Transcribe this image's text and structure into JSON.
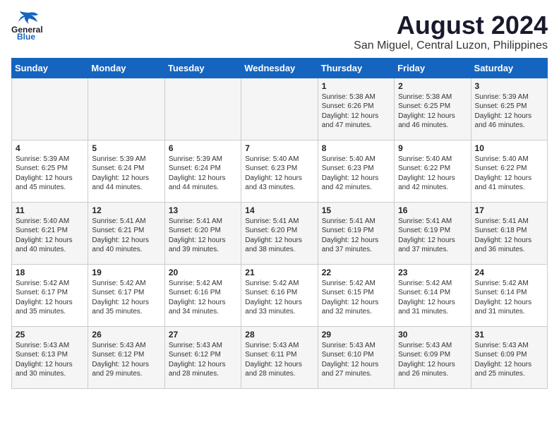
{
  "header": {
    "logo_general": "General",
    "logo_blue": "Blue",
    "month_year": "August 2024",
    "location": "San Miguel, Central Luzon, Philippines"
  },
  "days_of_week": [
    "Sunday",
    "Monday",
    "Tuesday",
    "Wednesday",
    "Thursday",
    "Friday",
    "Saturday"
  ],
  "weeks": [
    [
      {
        "day": "",
        "content": ""
      },
      {
        "day": "",
        "content": ""
      },
      {
        "day": "",
        "content": ""
      },
      {
        "day": "",
        "content": ""
      },
      {
        "day": "1",
        "content": "Sunrise: 5:38 AM\nSunset: 6:26 PM\nDaylight: 12 hours\nand 47 minutes."
      },
      {
        "day": "2",
        "content": "Sunrise: 5:38 AM\nSunset: 6:25 PM\nDaylight: 12 hours\nand 46 minutes."
      },
      {
        "day": "3",
        "content": "Sunrise: 5:39 AM\nSunset: 6:25 PM\nDaylight: 12 hours\nand 46 minutes."
      }
    ],
    [
      {
        "day": "4",
        "content": "Sunrise: 5:39 AM\nSunset: 6:25 PM\nDaylight: 12 hours\nand 45 minutes."
      },
      {
        "day": "5",
        "content": "Sunrise: 5:39 AM\nSunset: 6:24 PM\nDaylight: 12 hours\nand 44 minutes."
      },
      {
        "day": "6",
        "content": "Sunrise: 5:39 AM\nSunset: 6:24 PM\nDaylight: 12 hours\nand 44 minutes."
      },
      {
        "day": "7",
        "content": "Sunrise: 5:40 AM\nSunset: 6:23 PM\nDaylight: 12 hours\nand 43 minutes."
      },
      {
        "day": "8",
        "content": "Sunrise: 5:40 AM\nSunset: 6:23 PM\nDaylight: 12 hours\nand 42 minutes."
      },
      {
        "day": "9",
        "content": "Sunrise: 5:40 AM\nSunset: 6:22 PM\nDaylight: 12 hours\nand 42 minutes."
      },
      {
        "day": "10",
        "content": "Sunrise: 5:40 AM\nSunset: 6:22 PM\nDaylight: 12 hours\nand 41 minutes."
      }
    ],
    [
      {
        "day": "11",
        "content": "Sunrise: 5:40 AM\nSunset: 6:21 PM\nDaylight: 12 hours\nand 40 minutes."
      },
      {
        "day": "12",
        "content": "Sunrise: 5:41 AM\nSunset: 6:21 PM\nDaylight: 12 hours\nand 40 minutes."
      },
      {
        "day": "13",
        "content": "Sunrise: 5:41 AM\nSunset: 6:20 PM\nDaylight: 12 hours\nand 39 minutes."
      },
      {
        "day": "14",
        "content": "Sunrise: 5:41 AM\nSunset: 6:20 PM\nDaylight: 12 hours\nand 38 minutes."
      },
      {
        "day": "15",
        "content": "Sunrise: 5:41 AM\nSunset: 6:19 PM\nDaylight: 12 hours\nand 37 minutes."
      },
      {
        "day": "16",
        "content": "Sunrise: 5:41 AM\nSunset: 6:19 PM\nDaylight: 12 hours\nand 37 minutes."
      },
      {
        "day": "17",
        "content": "Sunrise: 5:41 AM\nSunset: 6:18 PM\nDaylight: 12 hours\nand 36 minutes."
      }
    ],
    [
      {
        "day": "18",
        "content": "Sunrise: 5:42 AM\nSunset: 6:17 PM\nDaylight: 12 hours\nand 35 minutes."
      },
      {
        "day": "19",
        "content": "Sunrise: 5:42 AM\nSunset: 6:17 PM\nDaylight: 12 hours\nand 35 minutes."
      },
      {
        "day": "20",
        "content": "Sunrise: 5:42 AM\nSunset: 6:16 PM\nDaylight: 12 hours\nand 34 minutes."
      },
      {
        "day": "21",
        "content": "Sunrise: 5:42 AM\nSunset: 6:16 PM\nDaylight: 12 hours\nand 33 minutes."
      },
      {
        "day": "22",
        "content": "Sunrise: 5:42 AM\nSunset: 6:15 PM\nDaylight: 12 hours\nand 32 minutes."
      },
      {
        "day": "23",
        "content": "Sunrise: 5:42 AM\nSunset: 6:14 PM\nDaylight: 12 hours\nand 31 minutes."
      },
      {
        "day": "24",
        "content": "Sunrise: 5:42 AM\nSunset: 6:14 PM\nDaylight: 12 hours\nand 31 minutes."
      }
    ],
    [
      {
        "day": "25",
        "content": "Sunrise: 5:43 AM\nSunset: 6:13 PM\nDaylight: 12 hours\nand 30 minutes."
      },
      {
        "day": "26",
        "content": "Sunrise: 5:43 AM\nSunset: 6:12 PM\nDaylight: 12 hours\nand 29 minutes."
      },
      {
        "day": "27",
        "content": "Sunrise: 5:43 AM\nSunset: 6:12 PM\nDaylight: 12 hours\nand 28 minutes."
      },
      {
        "day": "28",
        "content": "Sunrise: 5:43 AM\nSunset: 6:11 PM\nDaylight: 12 hours\nand 28 minutes."
      },
      {
        "day": "29",
        "content": "Sunrise: 5:43 AM\nSunset: 6:10 PM\nDaylight: 12 hours\nand 27 minutes."
      },
      {
        "day": "30",
        "content": "Sunrise: 5:43 AM\nSunset: 6:09 PM\nDaylight: 12 hours\nand 26 minutes."
      },
      {
        "day": "31",
        "content": "Sunrise: 5:43 AM\nSunset: 6:09 PM\nDaylight: 12 hours\nand 25 minutes."
      }
    ]
  ]
}
